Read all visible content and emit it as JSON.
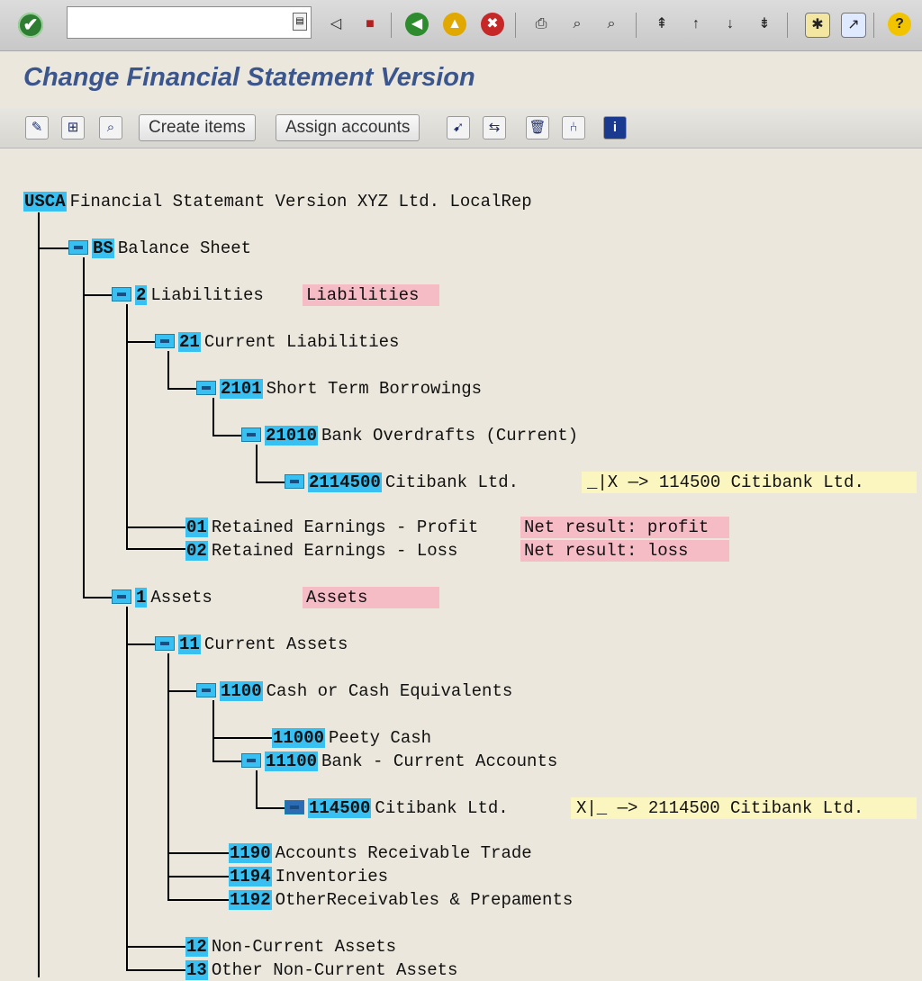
{
  "toolbar": {
    "command_value": "",
    "icons": [
      "enter-icon",
      "back-icon",
      "save-icon",
      "back-nav-icon",
      "exit-icon",
      "cancel-icon",
      "print-icon",
      "find-icon",
      "find-next-icon",
      "first-page-icon",
      "prev-page-icon",
      "next-page-icon",
      "last-page-icon",
      "new-session-icon",
      "shortcut-icon",
      "help-icon"
    ]
  },
  "title": "Change Financial Statement Version",
  "app_toolbar": {
    "create_items": "Create items",
    "assign_accounts": "Assign accounts"
  },
  "tree": {
    "root": {
      "key": "USCA",
      "label": "Financial Statemant Version XYZ Ltd. LocalRep"
    },
    "bs": {
      "key": "BS",
      "label": "Balance Sheet"
    },
    "liab": {
      "key": "2",
      "label": "Liabilities",
      "tag": "Liabilities"
    },
    "cur_liab": {
      "key": "21",
      "label": "Current Liabilities"
    },
    "stb": {
      "key": "2101",
      "label": "Short Term Borrowings"
    },
    "bod": {
      "key": "21010",
      "label": "Bank Overdrafts (Current)"
    },
    "citi_liab": {
      "key": "2114500",
      "label": "Citibank Ltd.",
      "assign": "_|X  —> 114500 Citibank Ltd."
    },
    "re_profit": {
      "key": "01",
      "label": "Retained Earnings - Profit",
      "tag": "Net result: profit"
    },
    "re_loss": {
      "key": "02",
      "label": "Retained Earnings - Loss",
      "tag": "Net result: loss"
    },
    "assets": {
      "key": "1",
      "label": "Assets",
      "tag": "Assets"
    },
    "cur_assets": {
      "key": "11",
      "label": "Current Assets"
    },
    "cash": {
      "key": "1100",
      "label": "Cash or Cash Equivalents"
    },
    "petty": {
      "key": "11000",
      "label": "Peety Cash"
    },
    "bank": {
      "key": "11100",
      "label": "Bank - Current Accounts"
    },
    "citi_asset": {
      "key": "114500",
      "label": "Citibank Ltd.",
      "assign": "X|_  —> 2114500 Citibank Ltd."
    },
    "ar": {
      "key": "1190",
      "label": "Accounts Receivable Trade"
    },
    "inv": {
      "key": "1194",
      "label": "Inventories"
    },
    "other_rec": {
      "key": "1192",
      "label": "OtherReceivables & Prepaments"
    },
    "noncur": {
      "key": "12",
      "label": "Non-Current Assets"
    },
    "other_noncur": {
      "key": "13",
      "label": "Other Non-Current Assets"
    }
  }
}
